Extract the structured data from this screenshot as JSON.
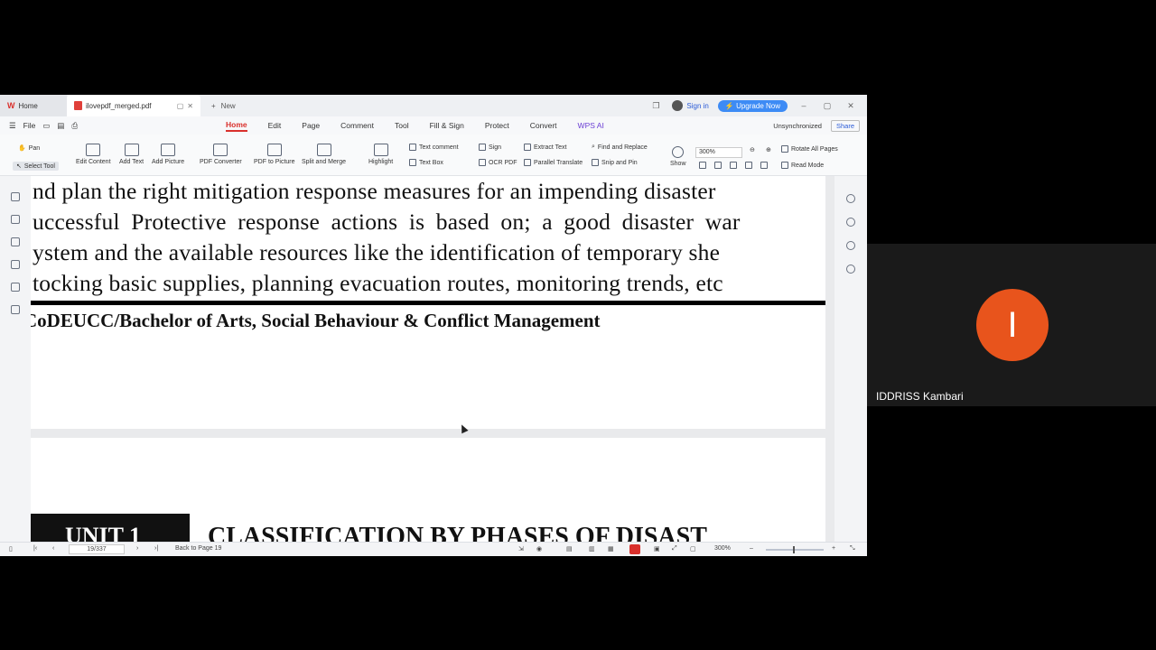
{
  "tabs": {
    "home_label": "Home",
    "doc_label": "ilovepdf_merged.pdf",
    "new_label": "New",
    "signin_label": "Sign in",
    "upgrade_label": "Upgrade Now"
  },
  "menu": {
    "file_label": "File",
    "items": [
      "Home",
      "Edit",
      "Page",
      "Comment",
      "Tool",
      "Fill & Sign",
      "Protect",
      "Convert",
      "WPS AI"
    ],
    "unsync_label": "Unsynchronized",
    "share_label": "Share"
  },
  "ribbon": {
    "pan": "Pan",
    "select_tool": "Select Tool",
    "edit_content": "Edit Content",
    "add_text": "Add Text",
    "add_picture": "Add Picture",
    "pdf_converter": "PDF Converter",
    "pdf_to_picture": "PDF to Picture",
    "split_merge": "Split and Merge",
    "highlight": "Highlight",
    "text_comment": "Text comment",
    "text_box": "Text Box",
    "sign": "Sign",
    "ocr_pdf": "OCR PDF",
    "extract_text": "Extract Text",
    "parallel_translate": "Parallel Translate",
    "find_replace": "Find and Replace",
    "snip_pin": "Snip and Pin",
    "show": "Show",
    "zoom_value": "300%",
    "rotate_all": "Rotate All Pages",
    "read_mode": "Read Mode"
  },
  "document": {
    "lines": [
      "nd plan the right mitigation response measures for an impending disaster",
      "uccessful Protective response actions is based on; a good disaster war",
      "ystem and the available resources like the identification of temporary she",
      "tocking basic supplies, planning evacuation routes, monitoring trends, etc"
    ],
    "footer": "CoDEUCC/Bachelor of Arts, Social Behaviour & Conflict Management",
    "unit_label": "UNIT 1",
    "unit_heading": "CLASSIFICATION BY PHASES OF DISAST"
  },
  "status": {
    "page_indicator": "19/337",
    "back_to_page": "Back to Page 19",
    "zoom": "300%"
  },
  "participant": {
    "initial": "I",
    "name": "IDDRISS Kambari",
    "avatar_color": "#e8541c"
  }
}
